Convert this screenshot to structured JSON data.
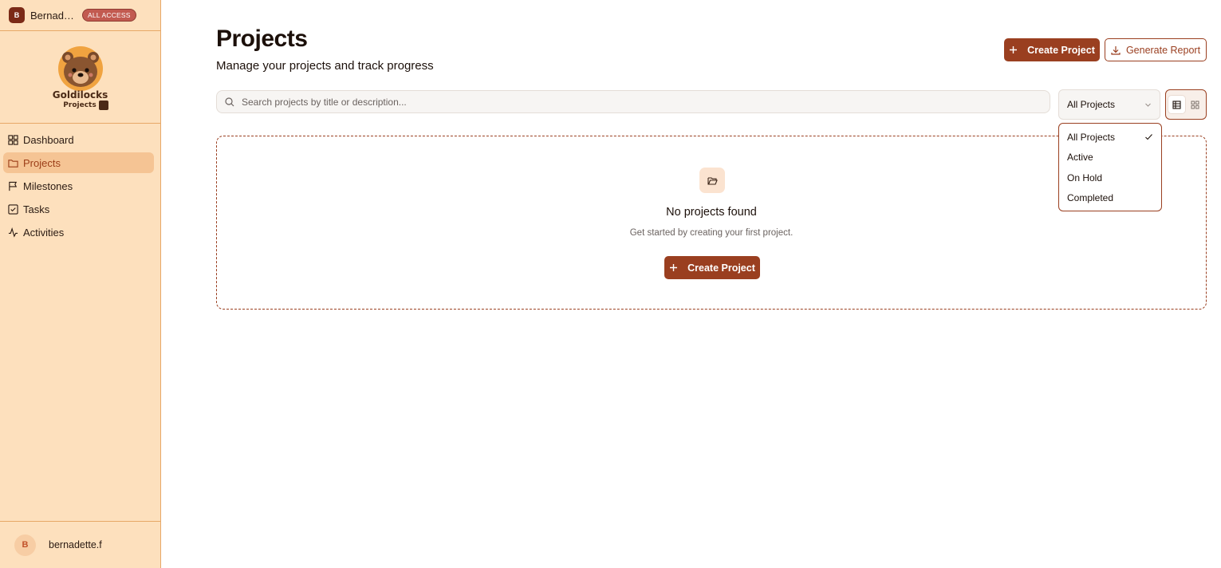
{
  "workspace": {
    "initial": "B",
    "name": "Bernadette",
    "badge": "ALL ACCESS"
  },
  "logo": {
    "name": "Goldilocks",
    "sub": "Projects"
  },
  "nav": [
    {
      "label": "Dashboard",
      "icon": "dashboard-icon",
      "active": false
    },
    {
      "label": "Projects",
      "icon": "folder-icon",
      "active": true
    },
    {
      "label": "Milestones",
      "icon": "flag-icon",
      "active": false
    },
    {
      "label": "Tasks",
      "icon": "checkbox-icon",
      "active": false
    },
    {
      "label": "Activities",
      "icon": "activity-icon",
      "active": false
    }
  ],
  "user": {
    "initial": "B",
    "name": "bernadette.f"
  },
  "header": {
    "title": "Projects",
    "subtitle": "Manage your projects and track progress",
    "create_label": "Create Project",
    "report_label": "Generate Report"
  },
  "search": {
    "placeholder": "Search projects by title or description..."
  },
  "filter": {
    "selected": "All Projects",
    "options": [
      "All Projects",
      "Active",
      "On Hold",
      "Completed"
    ]
  },
  "empty_state": {
    "title": "No projects found",
    "description": "Get started by creating your first project.",
    "button_label": "Create Project"
  },
  "colors": {
    "accent": "#9a3f20",
    "sidebar_bg": "#fde0bd",
    "active_nav": "#f5c494"
  }
}
